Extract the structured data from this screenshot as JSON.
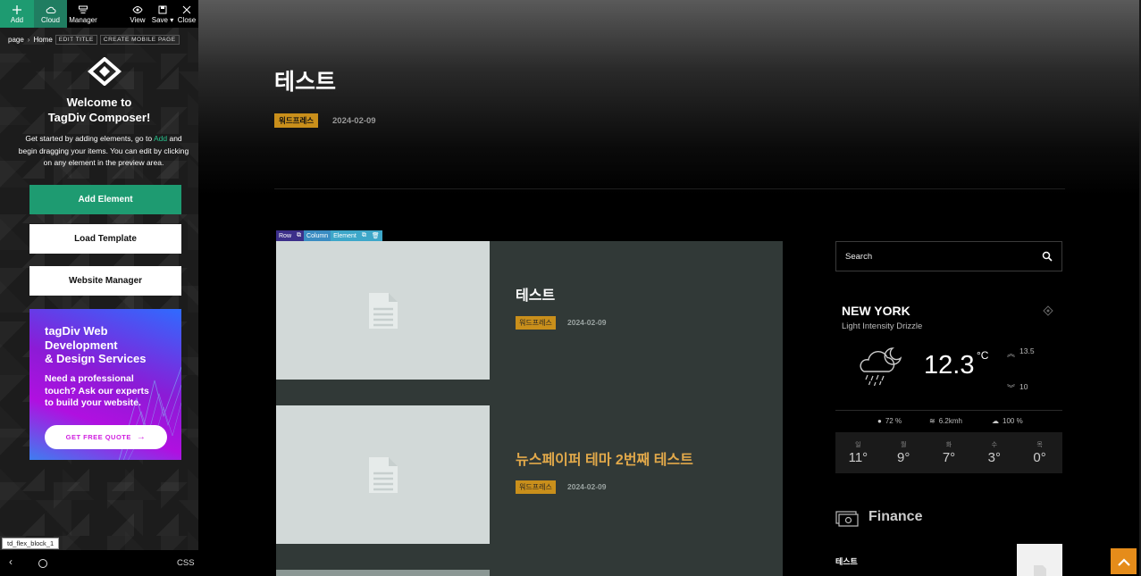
{
  "toolbar": {
    "add": "Add",
    "cloud": "Cloud",
    "manager": "Manager",
    "view": "View",
    "save": "Save",
    "save_caret": "▾",
    "close": "Close"
  },
  "breadcrumb": {
    "page": "page",
    "separator": "›",
    "home": "Home",
    "edit_title": "EDIT TITLE",
    "create_mobile": "CREATE MOBILE PAGE"
  },
  "welcome": {
    "title_line1": "Welcome to",
    "title_line2": "TagDiv Composer!",
    "desc_before": "Get started by adding elements, go to ",
    "desc_link": "Add",
    "desc_after": " and begin dragging your items. You can edit by clicking on any element in the preview area."
  },
  "buttons": {
    "add_element": "Add Element",
    "load_template": "Load Template",
    "website_manager": "Website Manager"
  },
  "promo": {
    "title_line1": "tagDiv Web",
    "title_line2": "Development",
    "title_line3": "& Design Services",
    "text_line1": "Need a professional",
    "text_line2": "touch? Ask our experts",
    "text_line3": "to build your website.",
    "cta": "GET FREE QUOTE",
    "cta_arrow": "→"
  },
  "block_tag": "td_flex_block_1",
  "bottom_bar": {
    "back": "‹",
    "css": "CSS"
  },
  "post_header": {
    "title": "테스트",
    "category": "워드프레스",
    "date": "2024-02-09"
  },
  "edit_tags": {
    "row": "Row",
    "column": "Column",
    "element": "Element"
  },
  "flex_block": {
    "items": [
      {
        "title": "테스트",
        "category": "워드프레스",
        "date": "2024-02-09"
      },
      {
        "title": "뉴스페이퍼 테마 2번째 테스트",
        "category": "워드프레스",
        "date": "2024-02-09"
      }
    ]
  },
  "search": {
    "placeholder": "Search"
  },
  "weather": {
    "city": "NEW YORK",
    "description": "Light Intensity Drizzle",
    "temp": "12.3",
    "unit": "°C",
    "high": "13.5",
    "low": "10",
    "humidity": "72 %",
    "wind": "6.2kmh",
    "clouds": "100 %",
    "forecast": [
      {
        "day": "일",
        "temp": "11°"
      },
      {
        "day": "월",
        "temp": "9°"
      },
      {
        "day": "화",
        "temp": "7°"
      },
      {
        "day": "수",
        "temp": "3°"
      },
      {
        "day": "목",
        "temp": "0°"
      }
    ]
  },
  "finance": {
    "title": "Finance",
    "item_title": "테스트"
  },
  "colors": {
    "composer_green": "#1e9b71",
    "category_gold": "#c98f1b",
    "back_to_top": "#e58c1a"
  }
}
